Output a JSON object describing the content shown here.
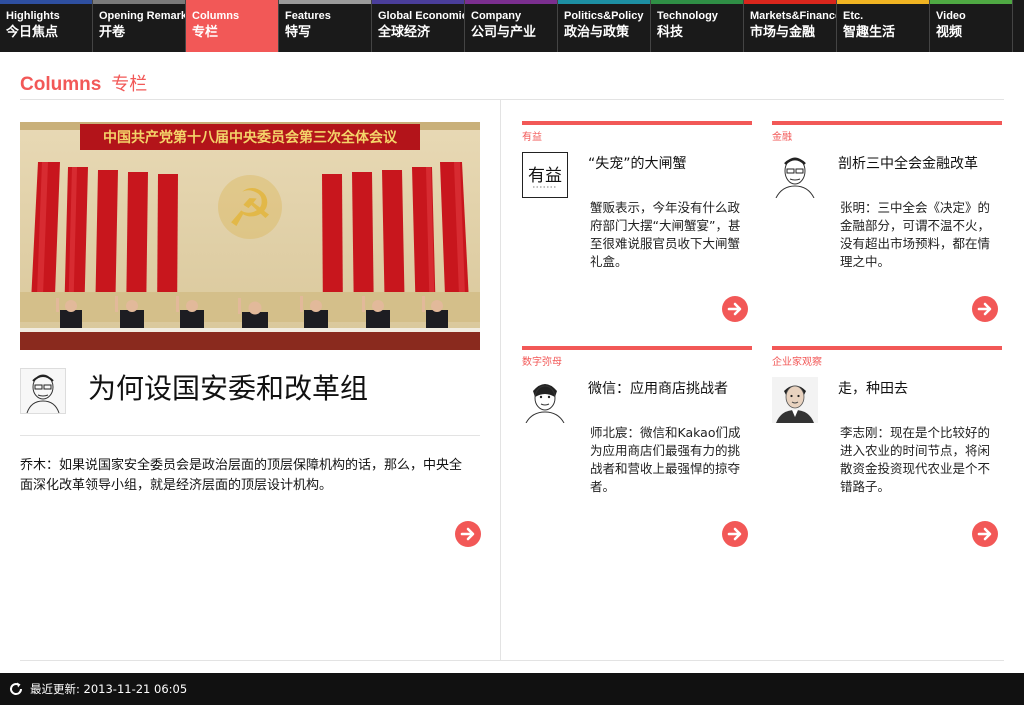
{
  "nav": {
    "items": [
      {
        "en": "Highlights",
        "zh": "今日焦点",
        "color": "#2e4fa0"
      },
      {
        "en": "Opening Remarks",
        "zh": "开卷",
        "color": "#7a7a7a"
      },
      {
        "en": "Columns",
        "zh": "专栏",
        "color": "#f25857",
        "active": true
      },
      {
        "en": "Features",
        "zh": "特写",
        "color": "#9b9b9b"
      },
      {
        "en": "Global Economics",
        "zh": "全球经济",
        "color": "#4a3e9a"
      },
      {
        "en": "Company",
        "zh": "公司与产业",
        "color": "#7b2f8f"
      },
      {
        "en": "Politics&Policy",
        "zh": "政治与政策",
        "color": "#1d8fa3"
      },
      {
        "en": "Technology",
        "zh": "科技",
        "color": "#2f8e45"
      },
      {
        "en": "Markets&Finance",
        "zh": "市场与金融",
        "color": "#d9261c"
      },
      {
        "en": "Etc.",
        "zh": "智趣生活",
        "color": "#f0b422"
      },
      {
        "en": "Video",
        "zh": "视频",
        "color": "#4fa943"
      }
    ]
  },
  "section": {
    "title_en": "Columns",
    "title_zh": "专栏"
  },
  "feature": {
    "photo_banner": "中国共产党第十八届中央委员会第三次全体会议",
    "title": "为何设国安委和改革组",
    "summary": "乔木：如果说国家安全委员会是政治层面的顶层保障机构的话，那么，中央全面深化改革领导小组，就是经济层面的顶层设计机构。",
    "avatar_icon": "columnist-sketch-avatar"
  },
  "cards": [
    {
      "tag": "有益",
      "title": "“失宠”的大闸蟹",
      "summary": "蟹贩表示，今年没有什么政府部门大摆“大闸蟹宴”，甚至很难说服官员收下大闸蟹礼盒。",
      "avatar_icon": "youyi-logo-icon",
      "logo_text": "有益"
    },
    {
      "tag": "金融",
      "title": "剖析三中全会金融改革",
      "summary": "张明：三中全会《决定》的金融部分，可谓不温不火，没有超出市场预料，都在情理之中。",
      "avatar_icon": "columnist-sketch-avatar"
    },
    {
      "tag": "数字弥母",
      "title": "微信：应用商店挑战者",
      "summary": "师北宸：微信和Kakao们成为应用商店们最强有力的挑战者和营收上最强悍的掠夺者。",
      "avatar_icon": "columnist-sketch-avatar"
    },
    {
      "tag": "企业家观察",
      "title": "走，种田去",
      "summary": "李志刚：现在是个比较好的进入农业的时间节点，将闲散资金投资现代农业是个不错路子。",
      "avatar_icon": "columnist-sketch-avatar"
    }
  ],
  "footer": {
    "status": "最近更新: 2013-11-21 06:05"
  },
  "colors": {
    "accent": "#f25857",
    "nav_bg": "#1a1a1a"
  }
}
